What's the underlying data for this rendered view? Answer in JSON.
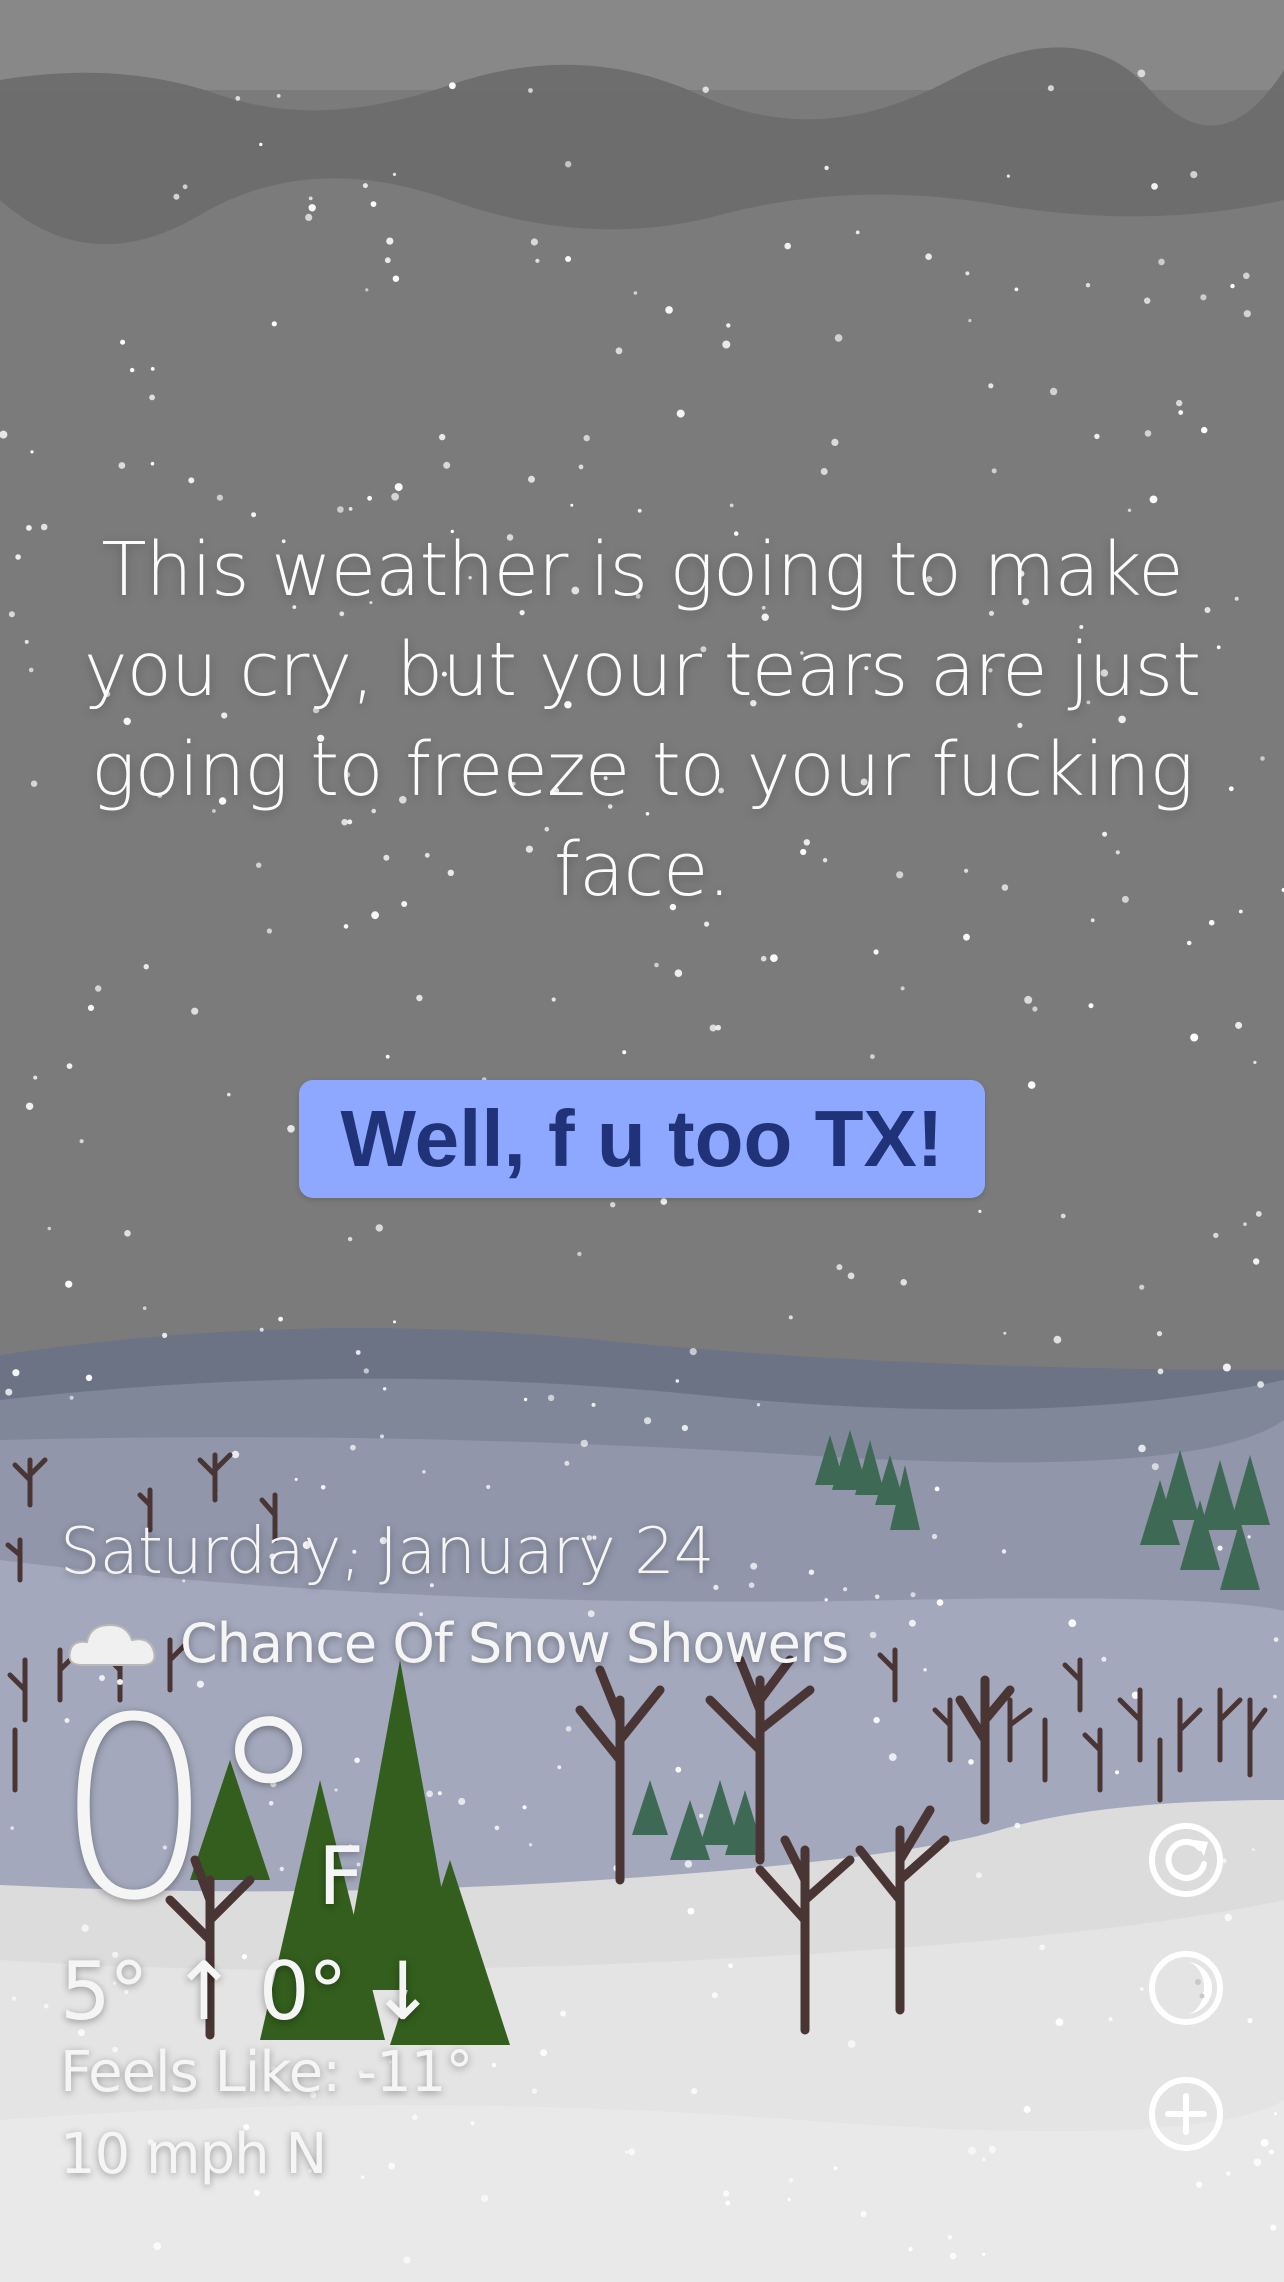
{
  "message": "This weather is going to make you cry, but your tears are just going to freeze to your fucking face.",
  "reply_button": {
    "label": "Well, f u too TX!"
  },
  "weather": {
    "date": "Saturday, January 24",
    "condition_icon": "cloud-snow-icon",
    "condition": "Chance Of Snow Showers",
    "temperature": "0°",
    "unit": "F",
    "hi_lo": "5° ↑ 0° ↓",
    "feels_like": "Feels Like: -11°",
    "wind": "10 mph N"
  },
  "controls": [
    {
      "icon": "refresh-icon"
    },
    {
      "icon": "moon-phase-icon"
    },
    {
      "icon": "add-location-icon"
    }
  ],
  "colors": {
    "sky": "#7a7a7a",
    "button_bg": "#8fa8ff",
    "button_text": "#203278",
    "tree_green": "#2e5a1c",
    "snow": "#e6e6e6"
  }
}
